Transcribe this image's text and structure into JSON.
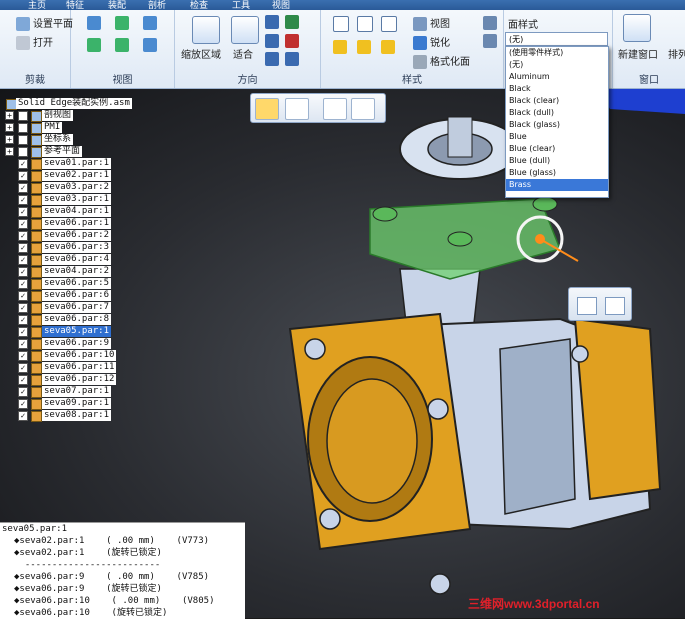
{
  "ribbon": {
    "tabs": [
      "主页",
      "特征",
      "装配",
      "剖析",
      "检查",
      "工具",
      "视图"
    ],
    "groups": {
      "clipboard": {
        "label": "剪裁",
        "items": [
          "设置平面",
          "打开"
        ]
      },
      "views": {
        "label": "视图"
      },
      "orient": {
        "label": "方向",
        "buttons": [
          "缩放区域",
          "适合"
        ]
      },
      "style": {
        "label": "样式",
        "buttons": [
          "视图",
          "锐化",
          "格式化面"
        ]
      },
      "face_style": {
        "label": "面样式"
      },
      "window": {
        "label": "窗口",
        "buttons": [
          "新建窗口",
          "排列"
        ]
      }
    }
  },
  "face_style_select": {
    "value": "(无)",
    "options": [
      "(使用零件样式)",
      "(无)",
      "Aluminum",
      "Black",
      "Black (clear)",
      "Black (dull)",
      "Black (glass)",
      "Blue",
      "Blue (clear)",
      "Blue (dull)",
      "Blue (glass)",
      "Brass"
    ],
    "highlighted": "Brass"
  },
  "tree": {
    "root": "Solid Edge装配实例.asm",
    "folders": [
      "剖视图",
      "PMI",
      "坐标系",
      "参考平面"
    ],
    "parts": [
      "seva01.par:1",
      "seva02.par:1",
      "seva03.par:2",
      "seva03.par:1",
      "seva04.par:1",
      "seva06.par:1",
      "seva06.par:2",
      "seva06.par:3",
      "seva06.par:4",
      "seva04.par:2",
      "seva06.par:5",
      "seva06.par:6",
      "seva06.par:7",
      "seva06.par:8",
      "seva05.par:1",
      "seva06.par:9",
      "seva06.par:10",
      "seva06.par:11",
      "seva06.par:12",
      "seva07.par:1",
      "seva09.par:1",
      "seva08.par:1"
    ],
    "selected": "seva05.par:1"
  },
  "output": {
    "header": "seva05.par:1",
    "rows": [
      "◆seva02.par:1    ( .00 mm)    (V773)",
      "◆seva02.par:1    (旋转已锁定)",
      "  -------------------------",
      "◆seva06.par:9    ( .00 mm)    (V785)",
      "◆seva06.par:9    (旋转已锁定)",
      "◆seva06.par:10    ( .00 mm)    (V805)",
      "◆seva06.par:10    (旋转已锁定)"
    ]
  },
  "watermark": "三维网www.3dportal.cn",
  "colors": {
    "brass": "#e0a020",
    "steel": "#c8d4e8",
    "selection": "#6fd16f",
    "accent": "#3a78d8"
  }
}
